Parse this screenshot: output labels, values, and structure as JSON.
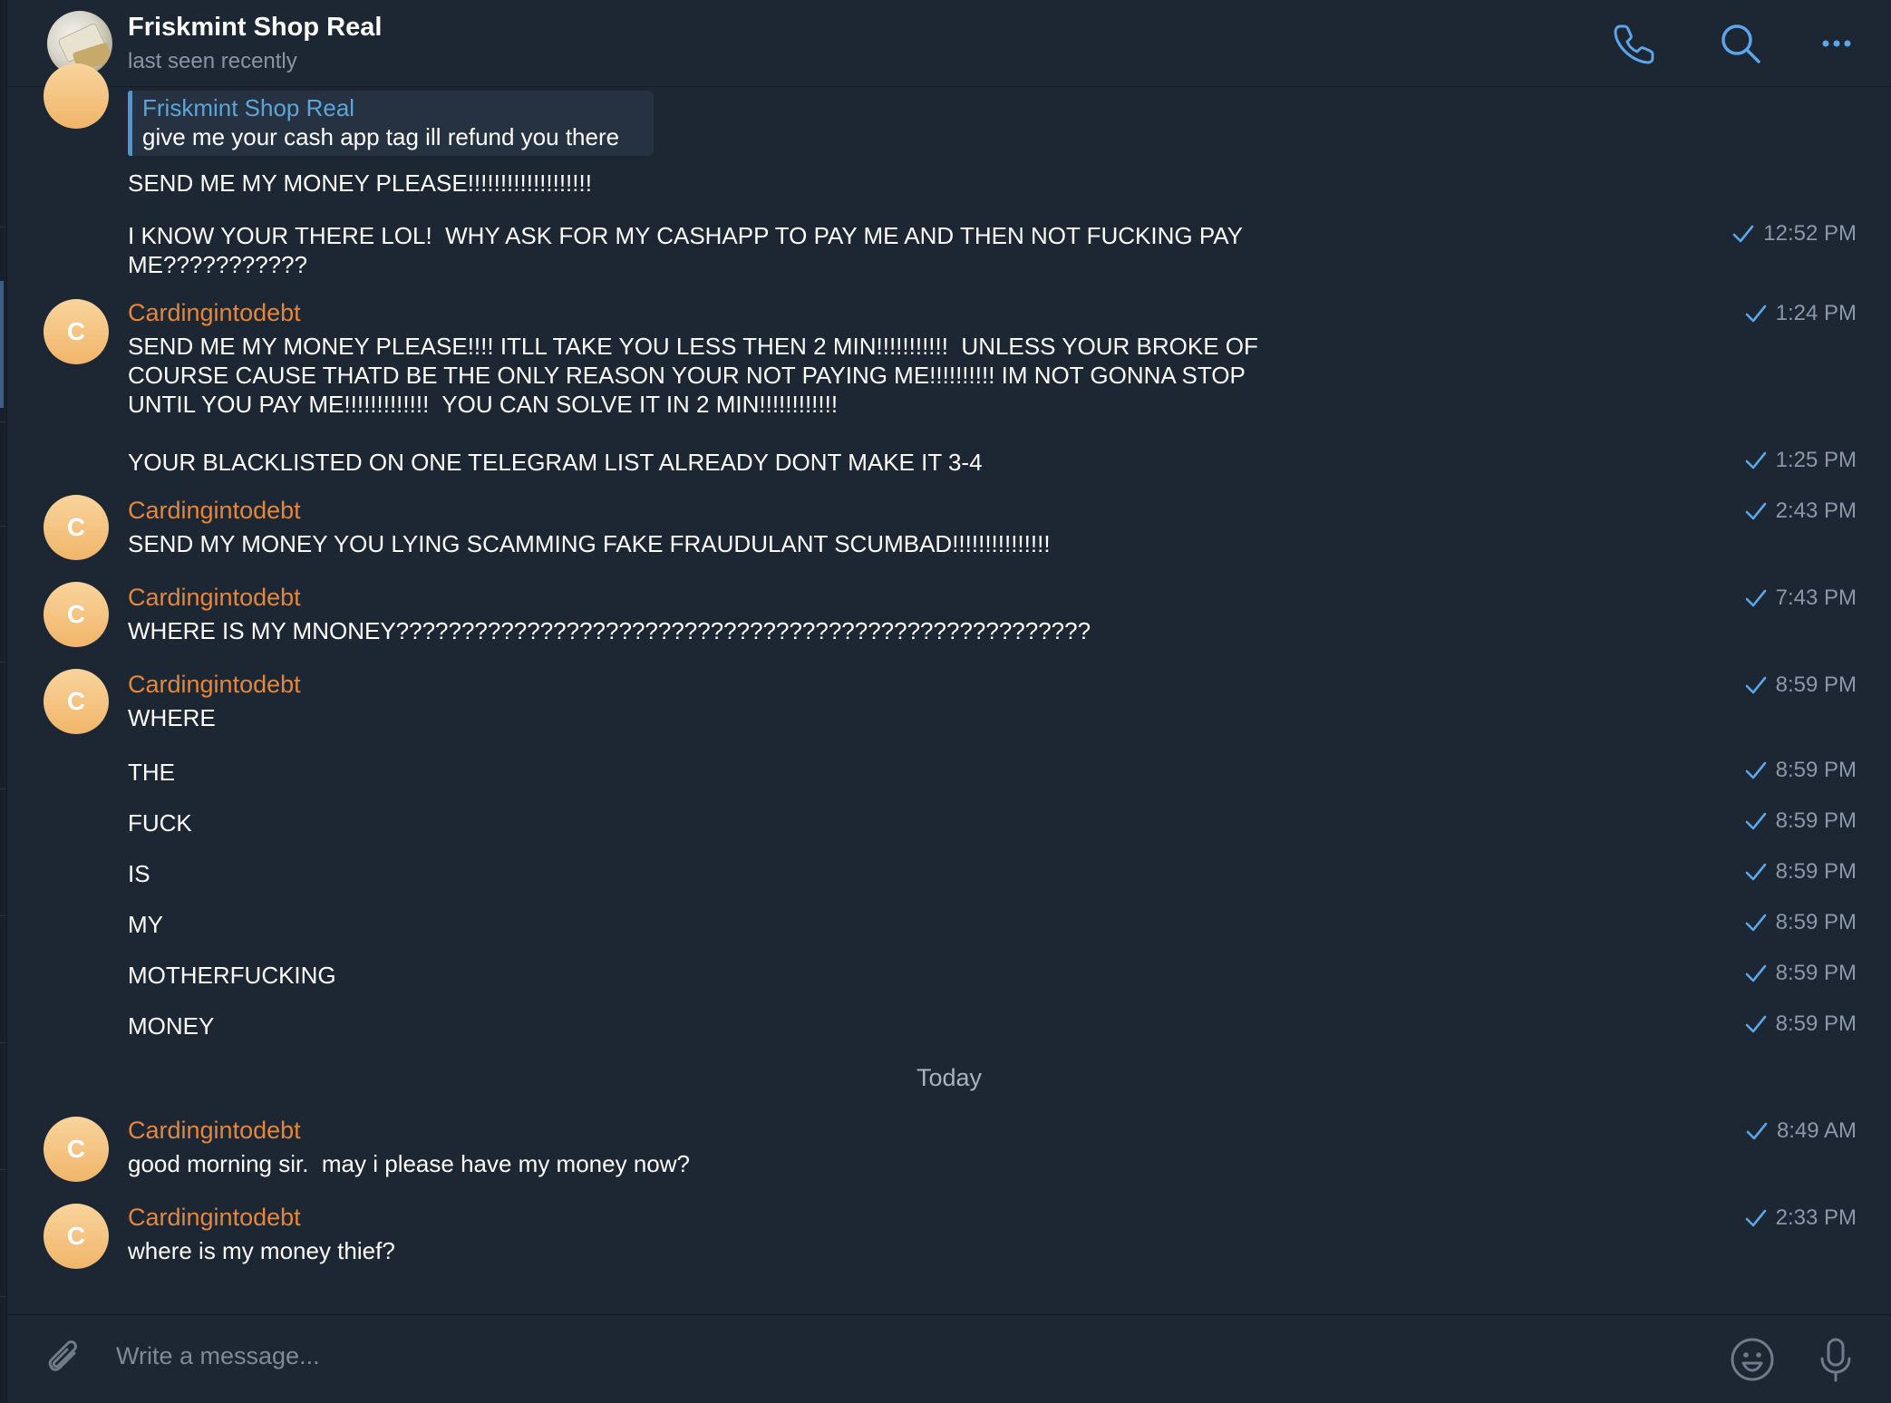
{
  "header": {
    "title": "Friskmint Shop Real",
    "status": "last seen recently",
    "icons": [
      "phone-icon",
      "search-icon",
      "more-icon"
    ]
  },
  "accent_color": "#4f97c8",
  "sender_color": "#e5863a",
  "reply": {
    "name": "Friskmint Shop Real",
    "text": "give me your cash app tag ill refund you there"
  },
  "messages": {
    "m1": {
      "text": "SEND ME MY MONEY PLEASE!!!!!!!!!!!!!!!!!!!"
    },
    "m2": {
      "text": "I KNOW YOUR THERE LOL!  WHY ASK FOR MY CASHAPP TO PAY ME AND THEN NOT FUCKING PAY ME???????????",
      "time": "12:52 PM"
    },
    "m3": {
      "sender": "Cardingintodebt",
      "avatar": "C",
      "text": "SEND ME MY MONEY PLEASE!!!! ITLL TAKE YOU LESS THEN 2 MIN!!!!!!!!!!!  UNLESS YOUR BROKE OF COURSE CAUSE THATD BE THE ONLY REASON YOUR NOT PAYING ME!!!!!!!!!! IM NOT GONNA STOP UNTIL YOU PAY ME!!!!!!!!!!!!!  YOU CAN SOLVE IT IN 2 MIN!!!!!!!!!!!!",
      "time": "1:24 PM"
    },
    "m4": {
      "text": "YOUR BLACKLISTED ON ONE TELEGRAM LIST ALREADY DONT MAKE IT 3-4",
      "time": "1:25 PM"
    },
    "m5": {
      "sender": "Cardingintodebt",
      "avatar": "C",
      "text": "SEND MY MONEY YOU LYING SCAMMING FAKE FRAUDULANT SCUMBAD!!!!!!!!!!!!!!!",
      "time": "2:43 PM"
    },
    "m6": {
      "sender": "Cardingintodebt",
      "avatar": "C",
      "text": "WHERE IS MY MNONEY?????????????????????????????????????????????????????",
      "time": "7:43 PM"
    },
    "m7": {
      "sender": "Cardingintodebt",
      "avatar": "C",
      "text": "WHERE",
      "time": "8:59 PM"
    },
    "m8": {
      "text": "THE",
      "time": "8:59 PM"
    },
    "m9": {
      "text": "FUCK",
      "time": "8:59 PM"
    },
    "m10": {
      "text": "IS",
      "time": "8:59 PM"
    },
    "m11": {
      "text": "MY",
      "time": "8:59 PM"
    },
    "m12": {
      "text": "MOTHERFUCKING",
      "time": "8:59 PM"
    },
    "m13": {
      "text": "MONEY",
      "time": "8:59 PM"
    },
    "m14": {
      "sender": "Cardingintodebt",
      "avatar": "C",
      "text": "good morning sir.  may i please have my money now?",
      "time": "8:49 AM"
    },
    "m15": {
      "sender": "Cardingintodebt",
      "avatar": "C",
      "text": "where is my money thief?",
      "time": "2:33 PM"
    }
  },
  "date_separator": "Today",
  "composer": {
    "placeholder": "Write a message...",
    "icons": [
      "attach-icon",
      "emoji-icon",
      "microphone-icon"
    ]
  }
}
